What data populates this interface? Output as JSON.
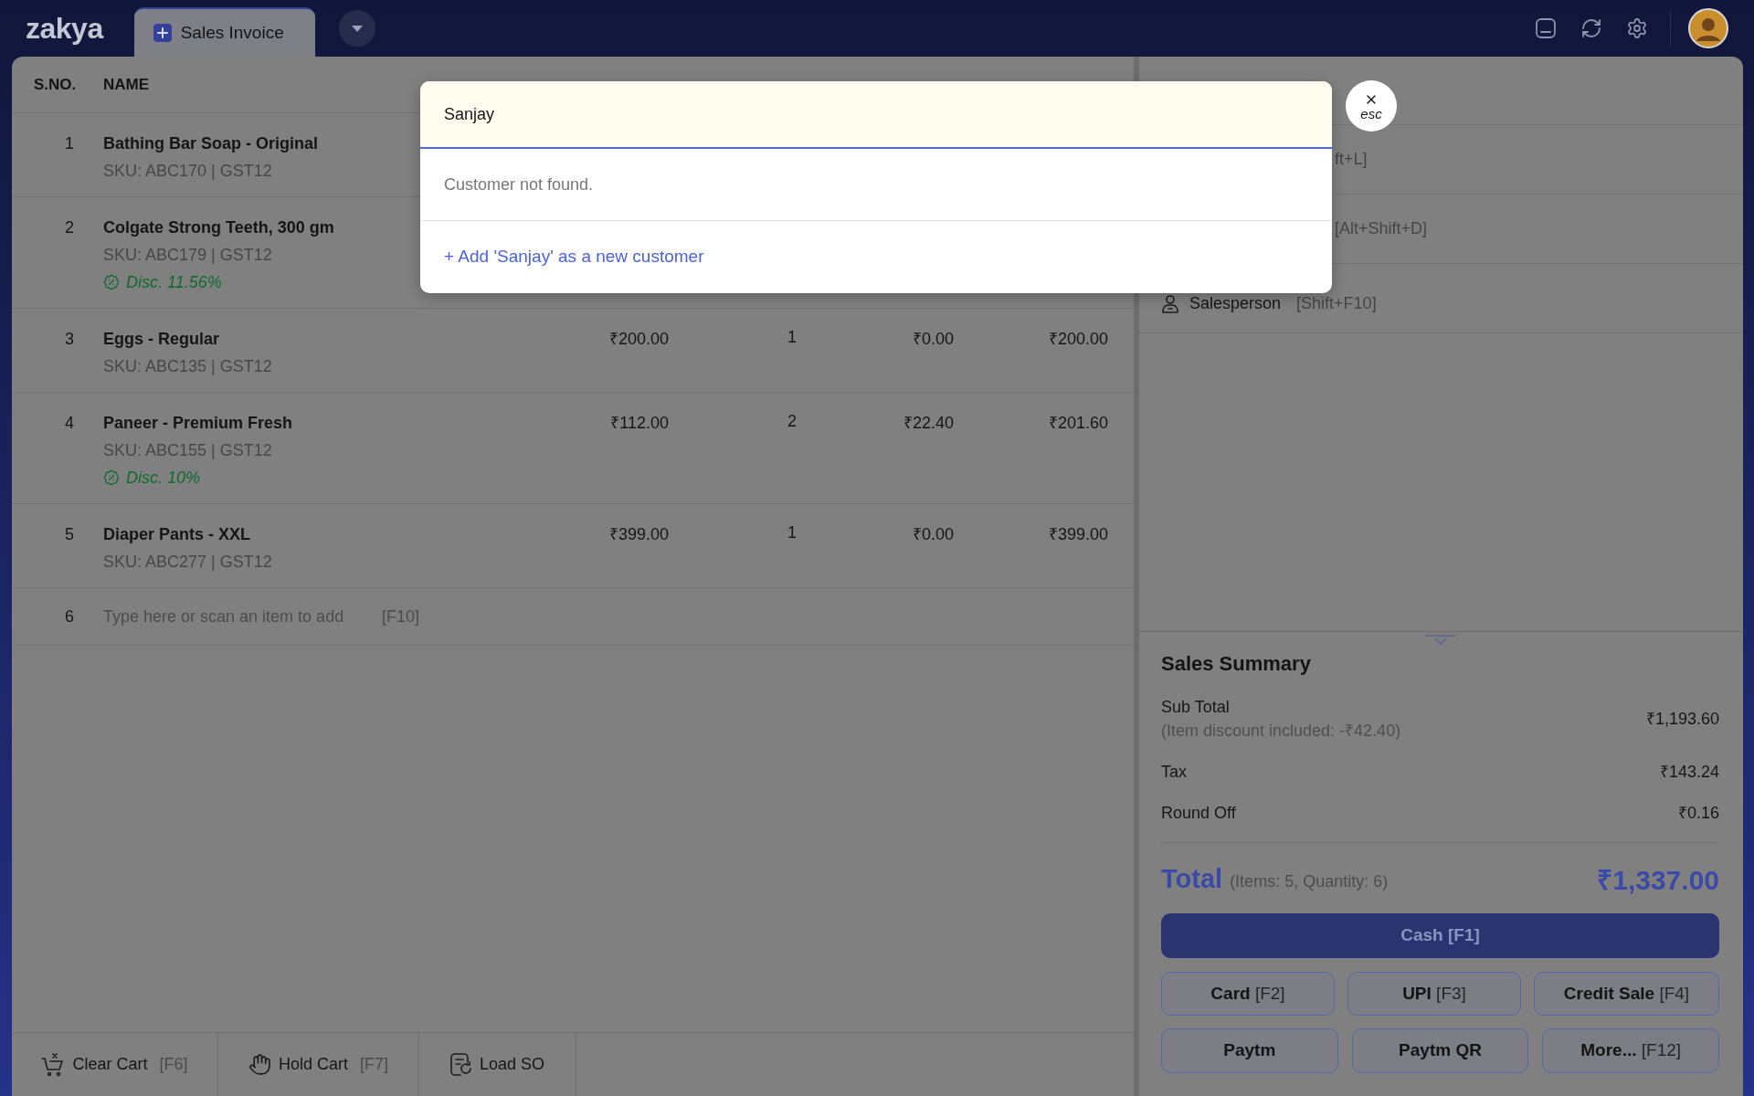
{
  "app": {
    "logo": "zakya"
  },
  "tabs": [
    {
      "label": "Sales Invoice",
      "selected": true
    }
  ],
  "cart": {
    "columns": [
      "S.NO.",
      "NAME"
    ],
    "rows": [
      {
        "number": "1",
        "name": "Bathing Bar Soap - Original",
        "sku": "SKU: ABC170 | GST12"
      },
      {
        "number": "2",
        "name": "Colgate Strong Teeth, 300 gm",
        "sku": "SKU: ABC179 | GST12",
        "discount_tag": "Disc. 11.56%"
      },
      {
        "number": "3",
        "name": "Eggs - Regular",
        "sku": "SKU: ABC135 | GST12",
        "rate": "₹200.00",
        "qty": "1",
        "discount": "₹0.00",
        "amount": "₹200.00"
      },
      {
        "number": "4",
        "name": "Paneer - Premium Fresh",
        "sku": "SKU: ABC155 | GST12",
        "discount_tag": "Disc. 10%",
        "rate": "₹112.00",
        "qty": "2",
        "discount": "₹22.40",
        "amount": "₹201.60"
      },
      {
        "number": "5",
        "name": "Diaper Pants - XXL",
        "sku": "SKU: ABC277 | GST12",
        "rate": "₹399.00",
        "qty": "1",
        "discount": "₹0.00",
        "amount": "₹399.00"
      }
    ],
    "new_item": {
      "number": "6",
      "placeholder": "Type here or scan an item to add",
      "shortcut": "[F10]"
    }
  },
  "cart_actions": [
    {
      "label": "Clear Cart",
      "shortcut": "[F6]"
    },
    {
      "label": "Hold Cart",
      "shortcut": "[F7]"
    },
    {
      "label": "Load SO"
    }
  ],
  "details": [
    {
      "kind": "partial",
      "shortcut": "ft+L]"
    },
    {
      "kind": "partial",
      "shortcut": "[Alt+Shift+D]"
    },
    {
      "kind": "field",
      "label": "Salesperson",
      "shortcut": "[Shift+F10]"
    }
  ],
  "summary": {
    "title": "Sales Summary",
    "lines": [
      {
        "label": "Sub Total",
        "note": "(Item discount included: -₹42.40)",
        "value": "₹1,193.60"
      },
      {
        "label": "Tax",
        "value": "₹143.24"
      },
      {
        "label": "Round Off",
        "value": "₹0.16"
      }
    ],
    "total": {
      "label": "Total",
      "detail": "(Items: 5, Quantity: 6)",
      "value": "₹1,337.00"
    }
  },
  "payments": [
    {
      "kind": "primary",
      "label": "Cash",
      "shortcut": "[F1]"
    },
    {
      "kind": "secondary",
      "label": "Card",
      "shortcut": "[F2]"
    },
    {
      "kind": "secondary",
      "label": "UPI",
      "shortcut": "[F3]"
    },
    {
      "kind": "secondary",
      "label": "Credit Sale",
      "shortcut": "[F4]"
    },
    {
      "kind": "secondary",
      "label": "Paytm"
    },
    {
      "kind": "secondary",
      "label": "Paytm QR"
    },
    {
      "kind": "secondary",
      "label": "More...",
      "shortcut": "[F12]"
    }
  ],
  "customer_search": {
    "value": "Sanjay",
    "message": "Customer not found.",
    "add_option": "+ Add 'Sanjay' as a new customer",
    "close_hint": "esc"
  }
}
